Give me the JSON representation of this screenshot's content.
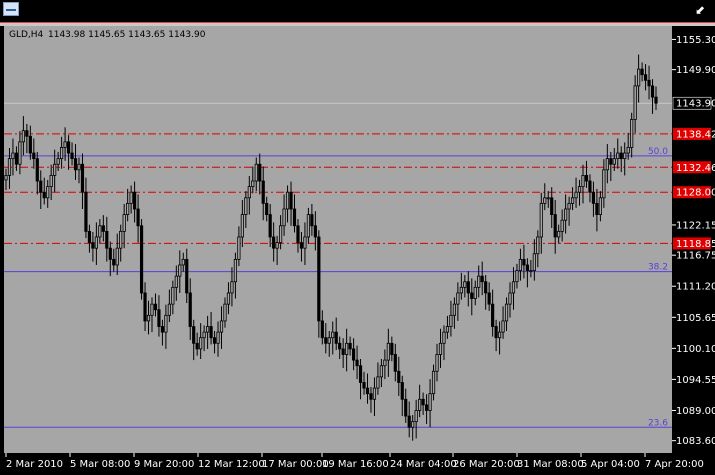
{
  "window": {
    "app_icon": "chart-window-icon",
    "control_icon": "collapse-arrow-icon"
  },
  "chart_header": {
    "symbol": "GLD,H4",
    "ohlc": "1143.98 1145.65 1143.65 1143.90"
  },
  "colors": {
    "background": "#a6a6a6",
    "candle": "#000000",
    "level_line": "#d90000",
    "level_tag": "#e00000",
    "fib_line": "#5b3fd8",
    "current_price": "#c8c8c8"
  },
  "chart_data": {
    "type": "candlestick",
    "title": "",
    "symbol": "GLD",
    "timeframe": "H4",
    "ylim": [
      1081.4,
      1157.7
    ],
    "y_ticks": [
      1155.3,
      1149.9,
      1143.9,
      1138.42,
      1132.46,
      1128.0,
      1122.15,
      1118.85,
      1116.75,
      1111.2,
      1105.65,
      1100.1,
      1094.55,
      1089.0,
      1083.6
    ],
    "y_tick_labels": [
      "1155.30",
      "1149.90",
      "1143.90",
      "1138.42",
      "1132.46",
      "1128.00",
      "1122.15",
      "1118.85",
      "1116.75",
      "1111.20",
      "1105.65",
      "1100.10",
      "1094.55",
      "1089.00",
      "1083.60"
    ],
    "x_tick_labels": [
      "2 Mar 2010",
      "5 Mar 08:00",
      "9 Mar 20:00",
      "12 Mar 12:00",
      "17 Mar 00:00",
      "19 Mar 16:00",
      "24 Mar 04:00",
      "26 Mar 20:00",
      "31 Mar 08:00",
      "5 Apr 04:00",
      "7 Apr 20:00"
    ],
    "current_price": 1143.9,
    "horizontal_levels": [
      1138.42,
      1132.46,
      1128.0,
      1118.85
    ],
    "fib_levels": [
      {
        "label": "50.0",
        "price": 1134.5
      },
      {
        "label": "38.2",
        "price": 1113.8
      },
      {
        "label": "23.6",
        "price": 1086.0
      }
    ],
    "closes": [
      1131,
      1134,
      1135,
      1133,
      1137,
      1139,
      1138,
      1135,
      1134,
      1130,
      1128,
      1127,
      1129,
      1131,
      1133,
      1134,
      1136,
      1137,
      1135,
      1134,
      1132,
      1133,
      1128,
      1121,
      1119,
      1118,
      1120,
      1122,
      1121,
      1118,
      1116,
      1115,
      1118,
      1121,
      1124,
      1126,
      1128,
      1125,
      1122,
      1110,
      1105,
      1106,
      1108,
      1107,
      1104,
      1103,
      1106,
      1108,
      1111,
      1113,
      1115,
      1116,
      1110,
      1104,
      1101,
      1100,
      1102,
      1103,
      1104,
      1102,
      1101,
      1103,
      1105,
      1108,
      1110,
      1112,
      1116,
      1120,
      1124,
      1127,
      1129,
      1130,
      1133,
      1130,
      1126,
      1124,
      1120,
      1118,
      1119,
      1122,
      1125,
      1128,
      1125,
      1122,
      1119,
      1118,
      1120,
      1124,
      1122,
      1120,
      1105,
      1102,
      1101,
      1102,
      1103,
      1101,
      1100,
      1099,
      1101,
      1100,
      1098,
      1097,
      1094,
      1093,
      1092,
      1091,
      1093,
      1095,
      1097,
      1098,
      1101,
      1099,
      1096,
      1094,
      1091,
      1088,
      1086,
      1087,
      1089,
      1091,
      1090,
      1089,
      1092,
      1096,
      1099,
      1101,
      1103,
      1104,
      1106,
      1108,
      1110,
      1111,
      1112,
      1110,
      1109,
      1111,
      1113,
      1112,
      1110,
      1108,
      1104,
      1102,
      1103,
      1105,
      1108,
      1110,
      1112,
      1114,
      1116,
      1115,
      1114,
      1114,
      1117,
      1120,
      1126,
      1127,
      1127,
      1124,
      1120,
      1121,
      1123,
      1125,
      1126,
      1127,
      1128,
      1129,
      1131,
      1130,
      1128,
      1126,
      1124,
      1127,
      1132,
      1134,
      1133,
      1134,
      1135,
      1134,
      1135,
      1136,
      1141,
      1147,
      1150,
      1149,
      1148,
      1147,
      1145,
      1143.9
    ]
  }
}
